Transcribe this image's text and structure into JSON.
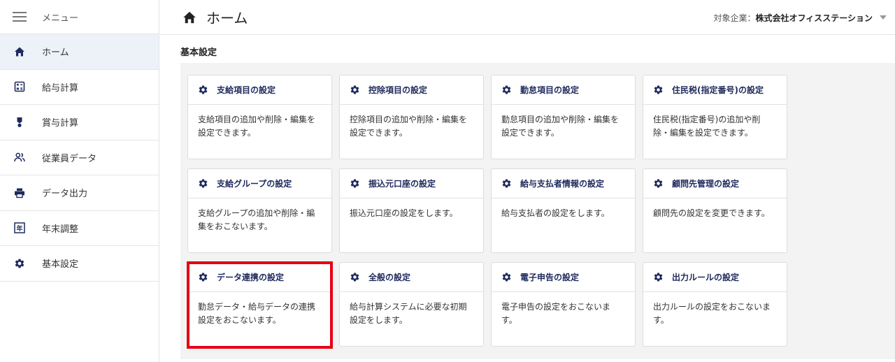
{
  "sidebar": {
    "menu_label": "メニュー",
    "items": [
      {
        "label": "ホーム",
        "icon": "home-icon"
      },
      {
        "label": "給与計算",
        "icon": "calculator-icon"
      },
      {
        "label": "賞与計算",
        "icon": "medal-icon"
      },
      {
        "label": "従業員データ",
        "icon": "people-icon"
      },
      {
        "label": "データ出力",
        "icon": "printer-icon"
      },
      {
        "label": "年末調整",
        "icon": "year-icon"
      },
      {
        "label": "基本設定",
        "icon": "gear-icon"
      }
    ],
    "year_glyph": "年"
  },
  "header": {
    "title": "ホーム",
    "company_label": "対象企業：",
    "company_name": "株式会社オフィスステーション"
  },
  "main": {
    "section_title": "基本設定",
    "cards": [
      {
        "title": "支給項目の設定",
        "desc": "支給項目の追加や削除・編集を設定できます。"
      },
      {
        "title": "控除項目の設定",
        "desc": "控除項目の追加や削除・編集を設定できます。"
      },
      {
        "title": "勤怠項目の設定",
        "desc": "勤怠項目の追加や削除・編集を設定できます。"
      },
      {
        "title": "住民税(指定番号)の設定",
        "desc": "住民税(指定番号)の追加や削除・編集を設定できます。"
      },
      {
        "title": "支給グループの設定",
        "desc": "支給グループの追加や削除・編集をおこないます。"
      },
      {
        "title": "振込元口座の設定",
        "desc": "振込元口座の設定をします。"
      },
      {
        "title": "給与支払者情報の設定",
        "desc": "給与支払者の設定をします。"
      },
      {
        "title": "顧問先管理の設定",
        "desc": "顧問先の設定を変更できます。"
      },
      {
        "title": "データ連携の設定",
        "desc": "勤怠データ・給与データの連携設定をおこないます。"
      },
      {
        "title": "全般の設定",
        "desc": "給与計算システムに必要な初期設定をします。"
      },
      {
        "title": "電子申告の設定",
        "desc": "電子申告の設定をおこないます。"
      },
      {
        "title": "出力ルールの設定",
        "desc": "出力ルールの設定をおこないます。"
      }
    ]
  },
  "colors": {
    "accent": "#1f2a5c",
    "active_bg": "#edf2f8",
    "highlight": "#e60012"
  }
}
